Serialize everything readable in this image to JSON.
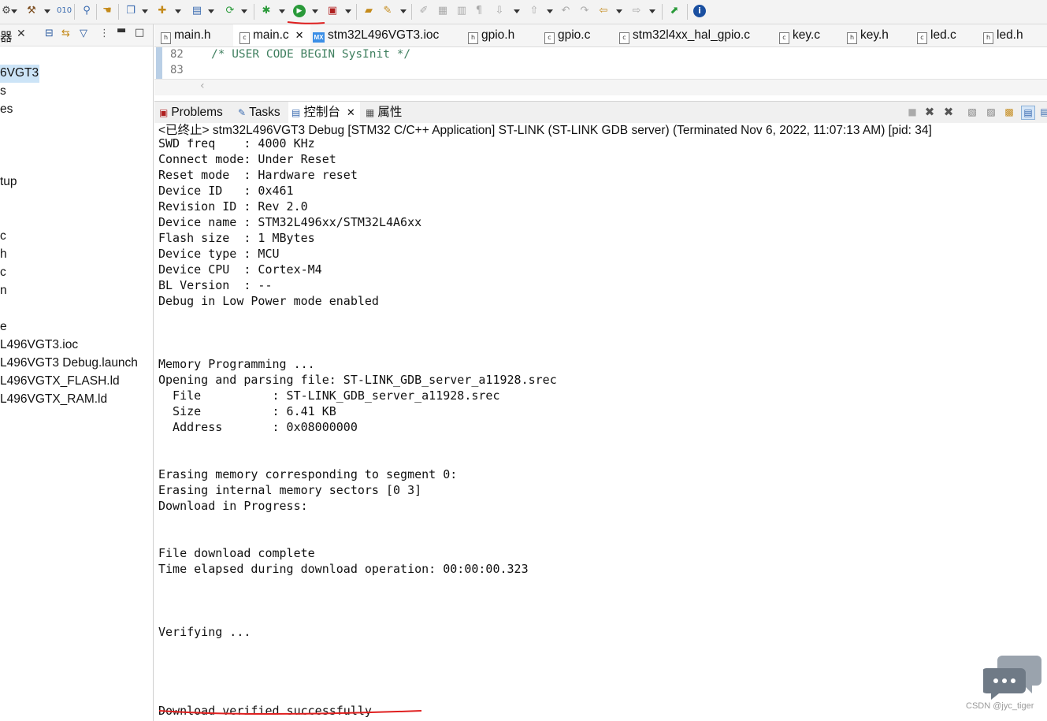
{
  "toolbar": {
    "icons": [
      "gear-icon",
      "build-hammer-icon",
      "binary-icon",
      "debug-search-icon",
      "hand-icon",
      "new-window-icon",
      "new-project-icon",
      "new-file-icon",
      "refresh-icon",
      "debug-bug-icon",
      "run-icon",
      "external-tools-icon",
      "open-folder-icon",
      "wand-icon",
      "edit-icon",
      "pin-icon",
      "pilcrow-icon",
      "next-annotation-icon",
      "prev-annotation-icon",
      "back-icon",
      "forward-icon",
      "open-perspective-icon",
      "info-icon"
    ]
  },
  "left_panel": {
    "header_label": "器",
    "items": [
      "6VGT3",
      "s",
      "es",
      "tup",
      "c",
      "h",
      "c",
      "n",
      "e",
      "L496VGT3.ioc",
      "L496VGT3 Debug.launch",
      "L496VGTX_FLASH.ld",
      "L496VGTX_RAM.ld"
    ]
  },
  "editor_tabs": [
    {
      "label": "main.h",
      "kind": "h"
    },
    {
      "label": "main.c",
      "kind": "c",
      "active": true,
      "closable": true
    },
    {
      "label": "stm32L496VGT3.ioc",
      "kind": "mx"
    },
    {
      "label": "gpio.h",
      "kind": "h"
    },
    {
      "label": "gpio.c",
      "kind": "c"
    },
    {
      "label": "stm32l4xx_hal_gpio.c",
      "kind": "c"
    },
    {
      "label": "key.c",
      "kind": "c"
    },
    {
      "label": "key.h",
      "kind": "h"
    },
    {
      "label": "led.c",
      "kind": "c"
    },
    {
      "label": "led.h",
      "kind": "h"
    }
  ],
  "editor": {
    "lines": [
      {
        "num": "82",
        "text": "/* USER CODE BEGIN SysInit */"
      },
      {
        "num": "83",
        "text": ""
      }
    ]
  },
  "console_tabs": [
    {
      "label": "Problems",
      "icon": "problems-icon"
    },
    {
      "label": "Tasks",
      "icon": "tasks-icon"
    },
    {
      "label": "控制台",
      "icon": "console-icon",
      "active": true,
      "closable": true
    },
    {
      "label": "属性",
      "icon": "properties-icon"
    }
  ],
  "console": {
    "status": "<已终止> stm32L496VGT3 Debug [STM32 C/C++ Application] ST-LINK (ST-LINK GDB server) (Terminated Nov 6, 2022, 11:07:13 AM) [pid: 34]",
    "lines": [
      "SWD freq    : 4000 KHz",
      "Connect mode: Under Reset",
      "Reset mode  : Hardware reset",
      "Device ID   : 0x461",
      "Revision ID : Rev 2.0",
      "Device name : STM32L496xx/STM32L4A6xx",
      "Flash size  : 1 MBytes",
      "Device type : MCU",
      "Device CPU  : Cortex-M4",
      "BL Version  : --",
      "Debug in Low Power mode enabled",
      "",
      "",
      "",
      "Memory Programming ...",
      "Opening and parsing file: ST-LINK_GDB_server_a11928.srec",
      "  File          : ST-LINK_GDB_server_a11928.srec",
      "  Size          : 6.41 KB",
      "  Address       : 0x08000000",
      "",
      "",
      "Erasing memory corresponding to segment 0:",
      "Erasing internal memory sectors [0 3]",
      "Download in Progress:",
      "",
      "",
      "File download complete",
      "Time elapsed during download operation: 00:00:00.323",
      "",
      "",
      "",
      "Verifying ...",
      "",
      "",
      "",
      "",
      "Download verified successfully"
    ]
  },
  "watermark": "CSDN @jyc_tiger"
}
